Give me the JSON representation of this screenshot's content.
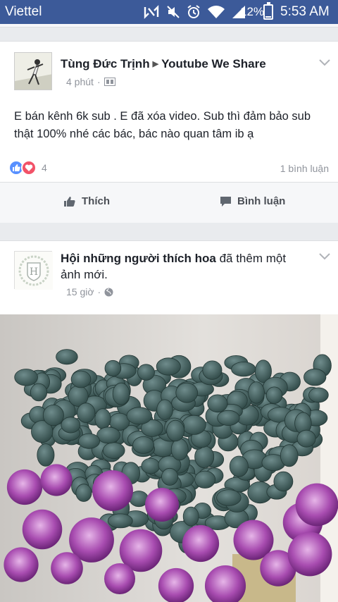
{
  "status_bar": {
    "carrier": "Viettel",
    "battery": "12%",
    "battery_level": 0.12,
    "time": "5:53 AM",
    "icons": [
      "nfc-icon",
      "mute-icon",
      "alarm-icon",
      "wifi-icon",
      "signal-icon",
      "battery-icon"
    ]
  },
  "post1": {
    "author": "Tùng Đức Trịnh",
    "target": "Youtube We Share",
    "time": "4 phút",
    "privacy_icon": "group-icon",
    "text": "E bán kênh 6k sub . E đã xóa video. Sub thì đảm bảo sub thật 100% nhé các bác, bác nào quan tâm ib ạ",
    "reaction_count": "4",
    "comments": "1 bình luận",
    "like_label": "Thích",
    "comment_label": "Bình luận"
  },
  "post2": {
    "page_name": "Hội những người thích hoa",
    "action": " đã thêm một ảnh mới.",
    "time": "15 giờ",
    "privacy_icon": "globe-icon",
    "avatar_letter": "H"
  },
  "colors": {
    "status_bar": "#3c5a99",
    "like": "#5890ff",
    "love": "#f25268"
  }
}
